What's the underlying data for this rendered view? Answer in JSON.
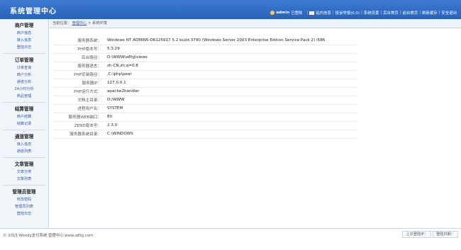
{
  "header": {
    "title": "系统管理中心",
    "admin_name": "admin",
    "online_status": "已登陆",
    "nav": [
      "站内信息",
      "投诉举报(0,0)",
      "系统设置",
      "后台首页",
      "前台首页",
      "刷新缓存",
      "安全退出"
    ]
  },
  "sidebar": {
    "groups": [
      {
        "title": "商户管理",
        "items": [
          "商户信息",
          "接入信息",
          "登陆日志"
        ]
      },
      {
        "title": "订单管理",
        "items": [
          "订单查询",
          "商户分析",
          "通道分析",
          "24小时分析",
          "商品管理"
        ]
      },
      {
        "title": "结算管理",
        "items": [
          "商户结算",
          "结算记录"
        ]
      },
      {
        "title": "通道管理",
        "items": [
          "接入信息",
          "通道列表"
        ]
      },
      {
        "title": "文章管理",
        "items": [
          "文章分类",
          "文章列表"
        ]
      },
      {
        "title": "管理员管理",
        "items": [
          "修改密码",
          "管理员列表",
          "登陆日志"
        ]
      }
    ]
  },
  "breadcrumb": {
    "prefix": "当前位置：",
    "link": "管理中心",
    "arrow": ">",
    "current": "系统环境"
  },
  "info": [
    {
      "label": "服务器系统：",
      "value": "Windows NT ADMIN5-D6125917 5.2 build 3790 (Windows Server 2003 Enterprise Edition Service Pack 2) i586"
    },
    {
      "label": "PHP版本号：",
      "value": "5.3.29"
    },
    {
      "label": "后台路径：",
      "value": "D:\\WWW\\a8tg\\views"
    },
    {
      "label": "服务器语言：",
      "value": "zh-CN,zh;q=0.8"
    },
    {
      "label": "PHP安装路径：",
      "value": ",C:\\php\\pear"
    },
    {
      "label": "服务器IP：",
      "value": "127.0.0.1"
    },
    {
      "label": "PHP运行方式：",
      "value": "apache2handler"
    },
    {
      "label": "文档主目录：",
      "value": "D:/WWW"
    },
    {
      "label": "进程用户名：",
      "value": "SYSTEM"
    },
    {
      "label": "服务器WEB端口：",
      "value": "80"
    },
    {
      "label": "ZEND版本号：",
      "value": "2.3.0"
    },
    {
      "label": "服务器系统目录：",
      "value": "C:\\WINDOWS"
    }
  ],
  "footer": {
    "copyright": "© 2015 Woody支付系统 管理中心 www.a8tg.com",
    "last_login_ip": "上次登陆IP：",
    "login_date": "登陆日期："
  },
  "colors": {
    "header_bg": "#2f6cc4",
    "link": "#2f5ea9",
    "sidebar_bg": "#f2f5fa"
  }
}
